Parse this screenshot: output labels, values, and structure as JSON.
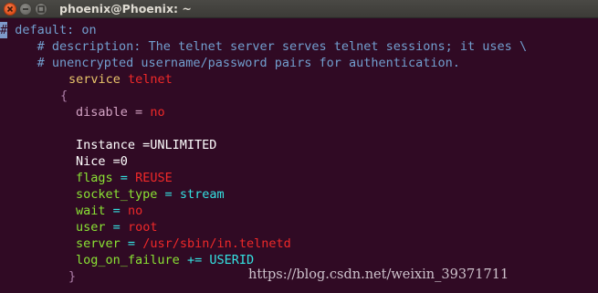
{
  "window": {
    "title": "phoenix@Phoenix: ~",
    "icons": {
      "close": "close-icon",
      "minimize": "minimize-icon",
      "maximize": "maximize-icon"
    }
  },
  "terminal": {
    "cursor_char": "#",
    "lines": {
      "l1": " default: on",
      "l2a": "     # description: The telnet server serves telnet sessions; it uses \\",
      "l3": "     # unencrypted username/password pairs for authentication.",
      "l4a": "service",
      "l4b": "telnet",
      "l5": "{",
      "l6a": "disable",
      "l6b": "=",
      "l6c": "no",
      "l7": "Instance =UNLIMITED",
      "l8": "Nice =0",
      "l9a": "flags",
      "l9b": "=",
      "l9c": "REUSE",
      "l10a": "socket_type",
      "l10b": "=",
      "l10c": "stream",
      "l11a": "wait",
      "l11b": "=",
      "l11c": "no",
      "l12a": "user",
      "l12b": "=",
      "l12c": "root",
      "l13a": "server",
      "l13b": "=",
      "l13c": "/usr/sbin/in.telnetd",
      "l14a": "log_on_failure",
      "l14b": "+=",
      "l14c": "USERID",
      "l15": "}"
    }
  },
  "watermark": "https://blog.csdn.net/weixin_39371711",
  "colors": {
    "background": "#300a24",
    "comment": "#729fcf",
    "keyword": "#e9c46a",
    "attribute": "#8ae234",
    "value": "#ef2929",
    "constant": "#34e2e2",
    "brace": "#ad7fa8"
  }
}
